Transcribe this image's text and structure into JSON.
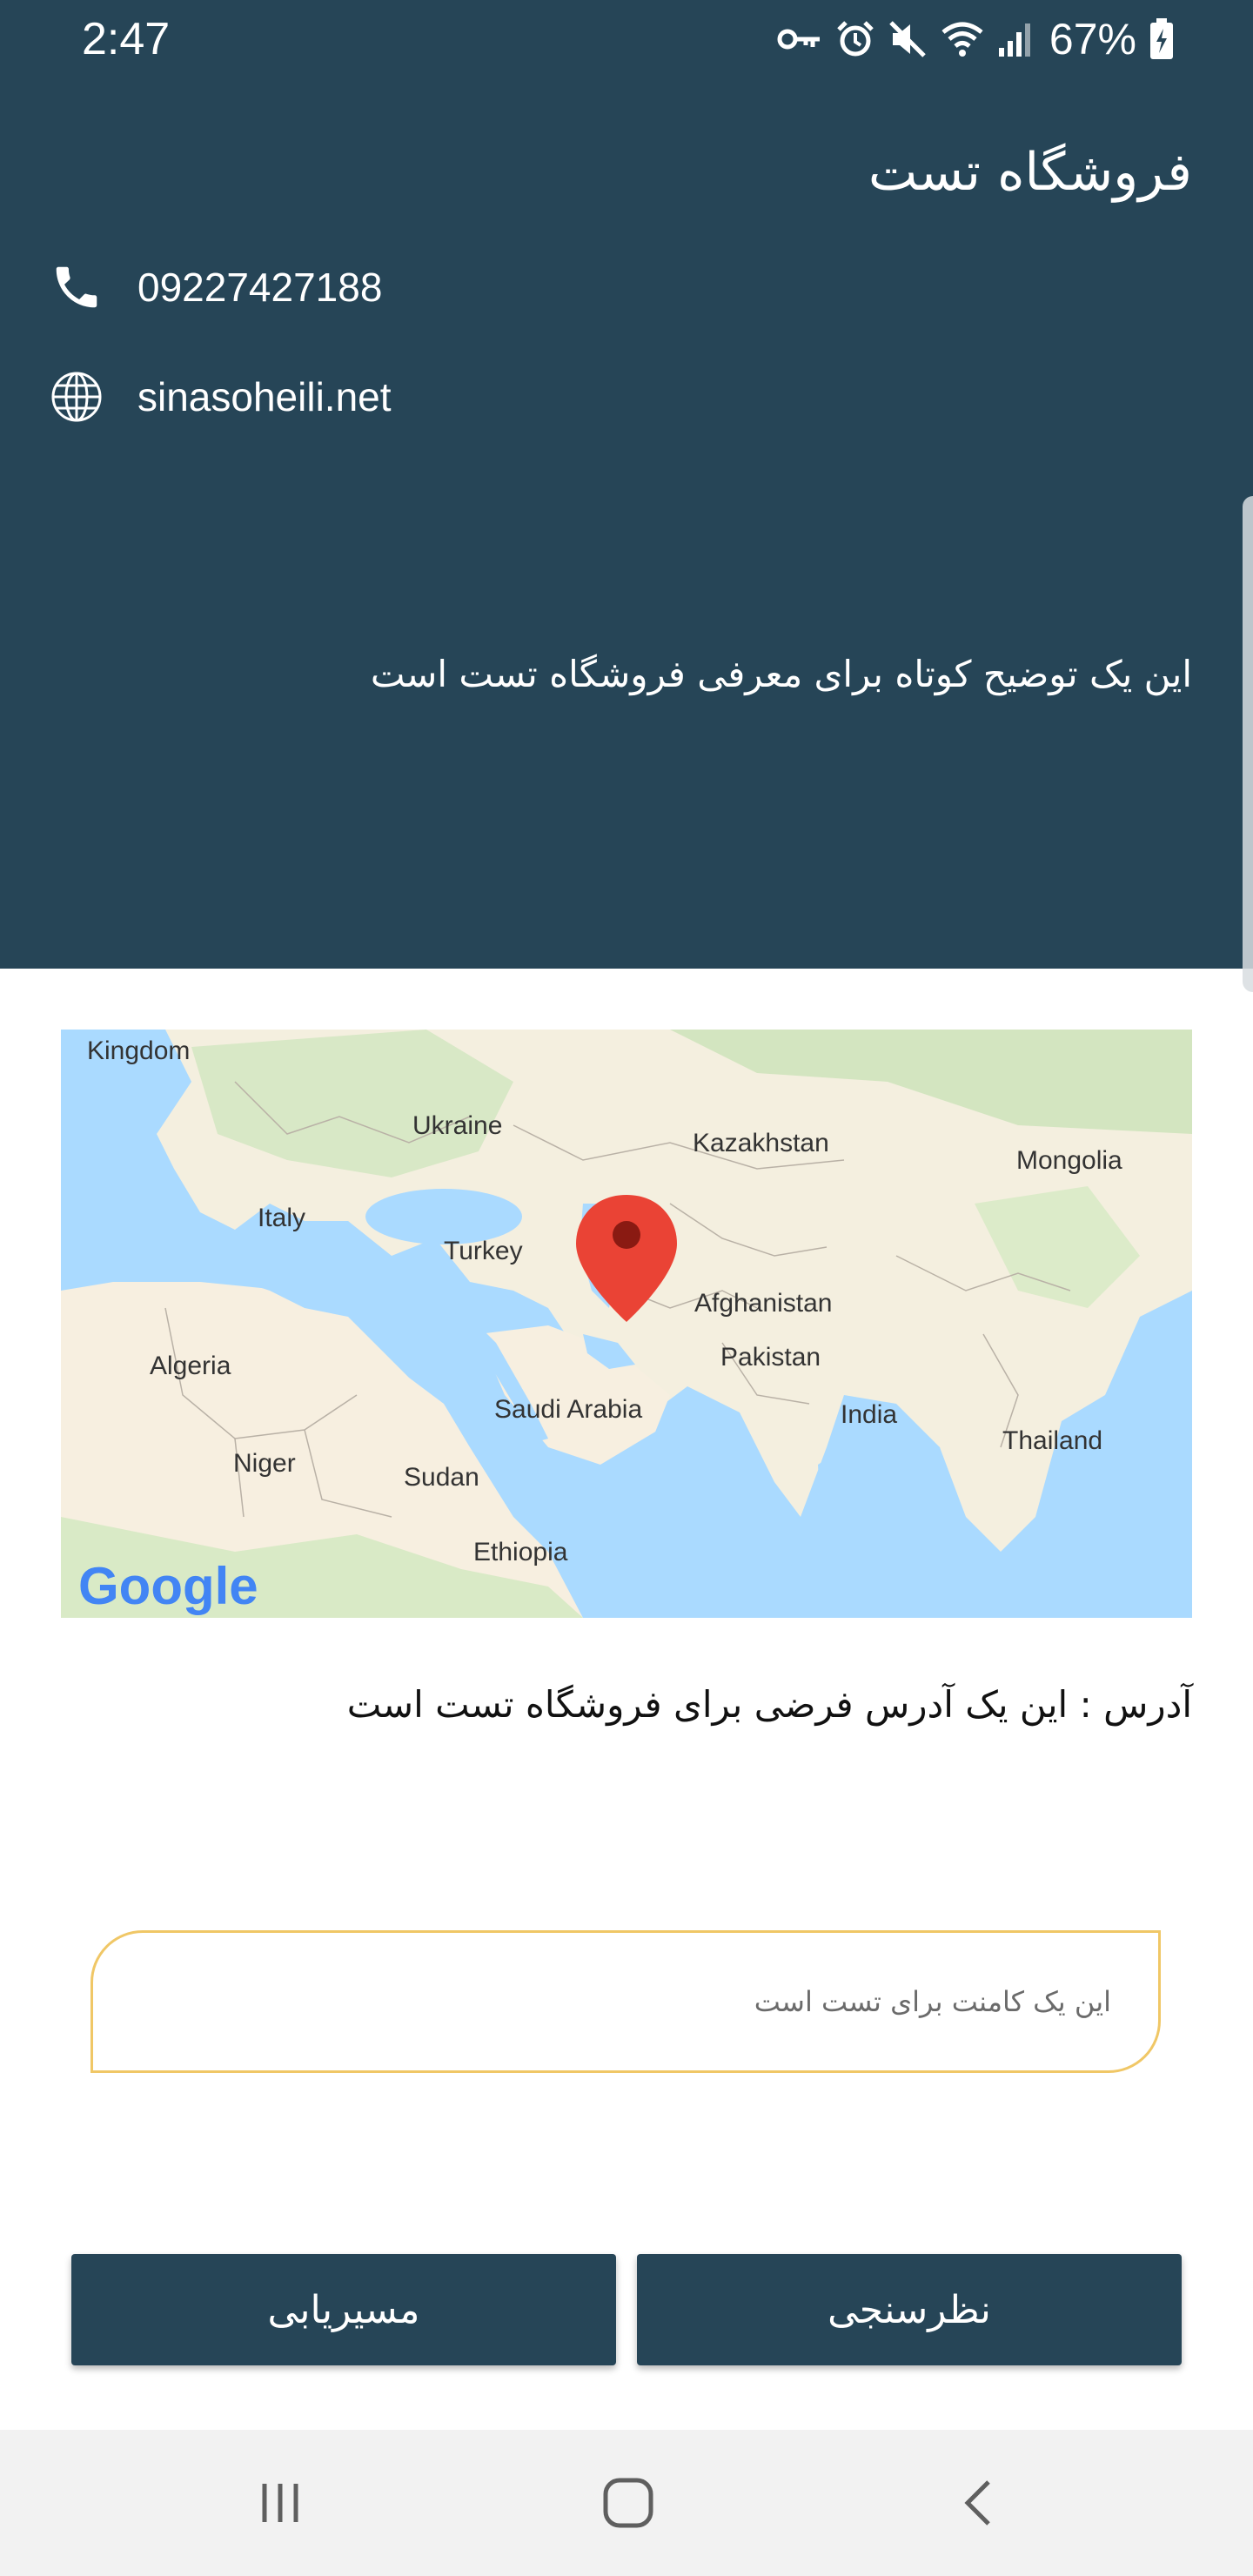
{
  "status_bar": {
    "time": "2:47",
    "battery": "67%"
  },
  "store": {
    "title": "فروشگاه تست",
    "phone": "09227427188",
    "website": "sinasoheili.net",
    "description": "این یک توضیح کوتاه برای معرفی فروشگاه تست است"
  },
  "map": {
    "labels": {
      "kingdom": "Kingdom",
      "ukraine": "Ukraine",
      "kazakhstan": "Kazakhstan",
      "mongolia": "Mongolia",
      "italy": "Italy",
      "turkey": "Turkey",
      "afghanistan": "Afghanistan",
      "pakistan": "Pakistan",
      "algeria": "Algeria",
      "saudi_arabia": "Saudi Arabia",
      "india": "India",
      "thailand": "Thailand",
      "niger": "Niger",
      "sudan": "Sudan",
      "ethiopia": "Ethiopia"
    },
    "attribution": "Google",
    "colors": {
      "water": "#aadaff",
      "land": "#f7f1e3",
      "green": "#d9ead0",
      "pin": "#ea4335"
    }
  },
  "address": {
    "text": "آدرس : این یک آدرس فرضی برای فروشگاه تست است"
  },
  "comment": {
    "text": "این یک کامنت برای تست است"
  },
  "buttons": {
    "route": "مسیریابی",
    "survey": "نظرسنجی"
  },
  "theme": {
    "primary": "#264557",
    "accent": "#f0c766"
  },
  "icons": {
    "phone": "phone-icon",
    "website": "globe-icon",
    "nav_recent": "recent-apps-icon",
    "nav_home": "home-icon",
    "nav_back": "back-icon"
  }
}
